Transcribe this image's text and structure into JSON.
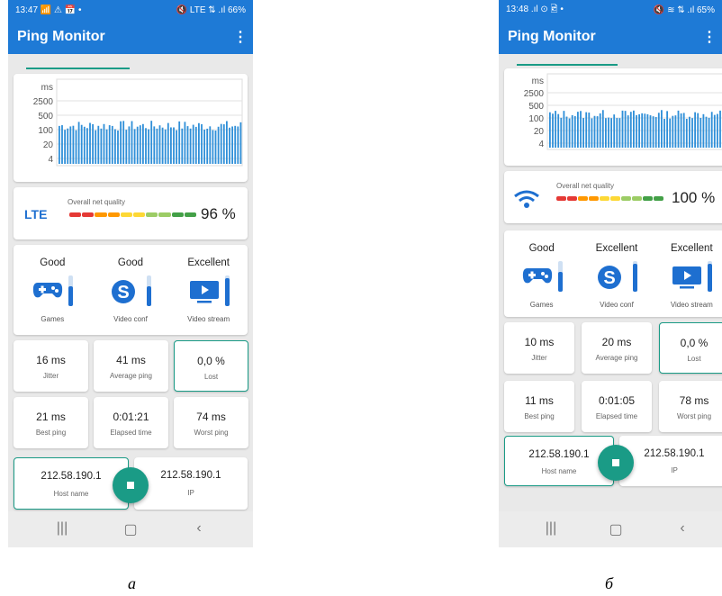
{
  "screens": [
    {
      "status_time": "13:47",
      "status_left_icons": "📶 ⚠ 📅 •",
      "status_right": "🔇 LTE ⇅ .ıl 66%",
      "app_title": "Ping Monitor",
      "chart": {
        "y_ticks": [
          "ms",
          "2500",
          "500",
          "100",
          "20",
          "4"
        ]
      },
      "network": {
        "type": "LTE",
        "icon": "lte-text",
        "overall_label": "Overall net quality",
        "quality": "96 %",
        "quality_fraction": 0.96
      },
      "services": [
        {
          "rating": "Good",
          "icon": "gamepad-icon",
          "name": "Games",
          "level": 0.65
        },
        {
          "rating": "Good",
          "icon": "skype-icon",
          "name": "Video conf",
          "level": 0.65
        },
        {
          "rating": "Excellent",
          "icon": "video-stream-icon",
          "name": "Video stream",
          "level": 0.9
        }
      ],
      "metrics": [
        {
          "value": "16 ms",
          "label": "Jitter"
        },
        {
          "value": "41 ms",
          "label": "Average ping"
        },
        {
          "value": "0,0 %",
          "label": "Lost"
        },
        {
          "value": "21 ms",
          "label": "Best ping"
        },
        {
          "value": "0:01:21",
          "label": "Elapsed time"
        },
        {
          "value": "74 ms",
          "label": "Worst ping"
        }
      ],
      "host": {
        "value": "212.58.190.1",
        "label": "Host name"
      },
      "ip": {
        "value": "212.58.190.1",
        "label": "IP"
      },
      "caption": "а"
    },
    {
      "status_time": "13:48",
      "status_left_icons": ".ıl ⊙ 🖻 •",
      "status_right": "🔇 ≋ ⇅ .ıl 65%",
      "app_title": "Ping Monitor",
      "chart": {
        "y_ticks": [
          "ms",
          "2500",
          "500",
          "100",
          "20",
          "4"
        ]
      },
      "network": {
        "type": "",
        "icon": "wifi-icon",
        "overall_label": "Overall net quality",
        "quality": "100 %",
        "quality_fraction": 1.0
      },
      "services": [
        {
          "rating": "Good",
          "icon": "gamepad-icon",
          "name": "Games",
          "level": 0.65
        },
        {
          "rating": "Excellent",
          "icon": "skype-icon",
          "name": "Video conf",
          "level": 0.9
        },
        {
          "rating": "Excellent",
          "icon": "video-stream-icon",
          "name": "Video stream",
          "level": 0.9
        }
      ],
      "metrics": [
        {
          "value": "10 ms",
          "label": "Jitter"
        },
        {
          "value": "20 ms",
          "label": "Average ping"
        },
        {
          "value": "0,0 %",
          "label": "Lost"
        },
        {
          "value": "11 ms",
          "label": "Best ping"
        },
        {
          "value": "0:01:05",
          "label": "Elapsed time"
        },
        {
          "value": "78 ms",
          "label": "Worst ping"
        }
      ],
      "host": {
        "value": "212.58.190.1",
        "label": "Host name"
      },
      "ip": {
        "value": "212.58.190.1",
        "label": "IP"
      },
      "caption": "б"
    }
  ],
  "colors": {
    "primary": "#1e7ad6",
    "accent": "#1a9b86",
    "bar": "#2f8fd8",
    "quality_red": "#e53935",
    "quality_orange": "#ff9800",
    "quality_yellow": "#fdd835",
    "quality_green": "#43a047"
  }
}
